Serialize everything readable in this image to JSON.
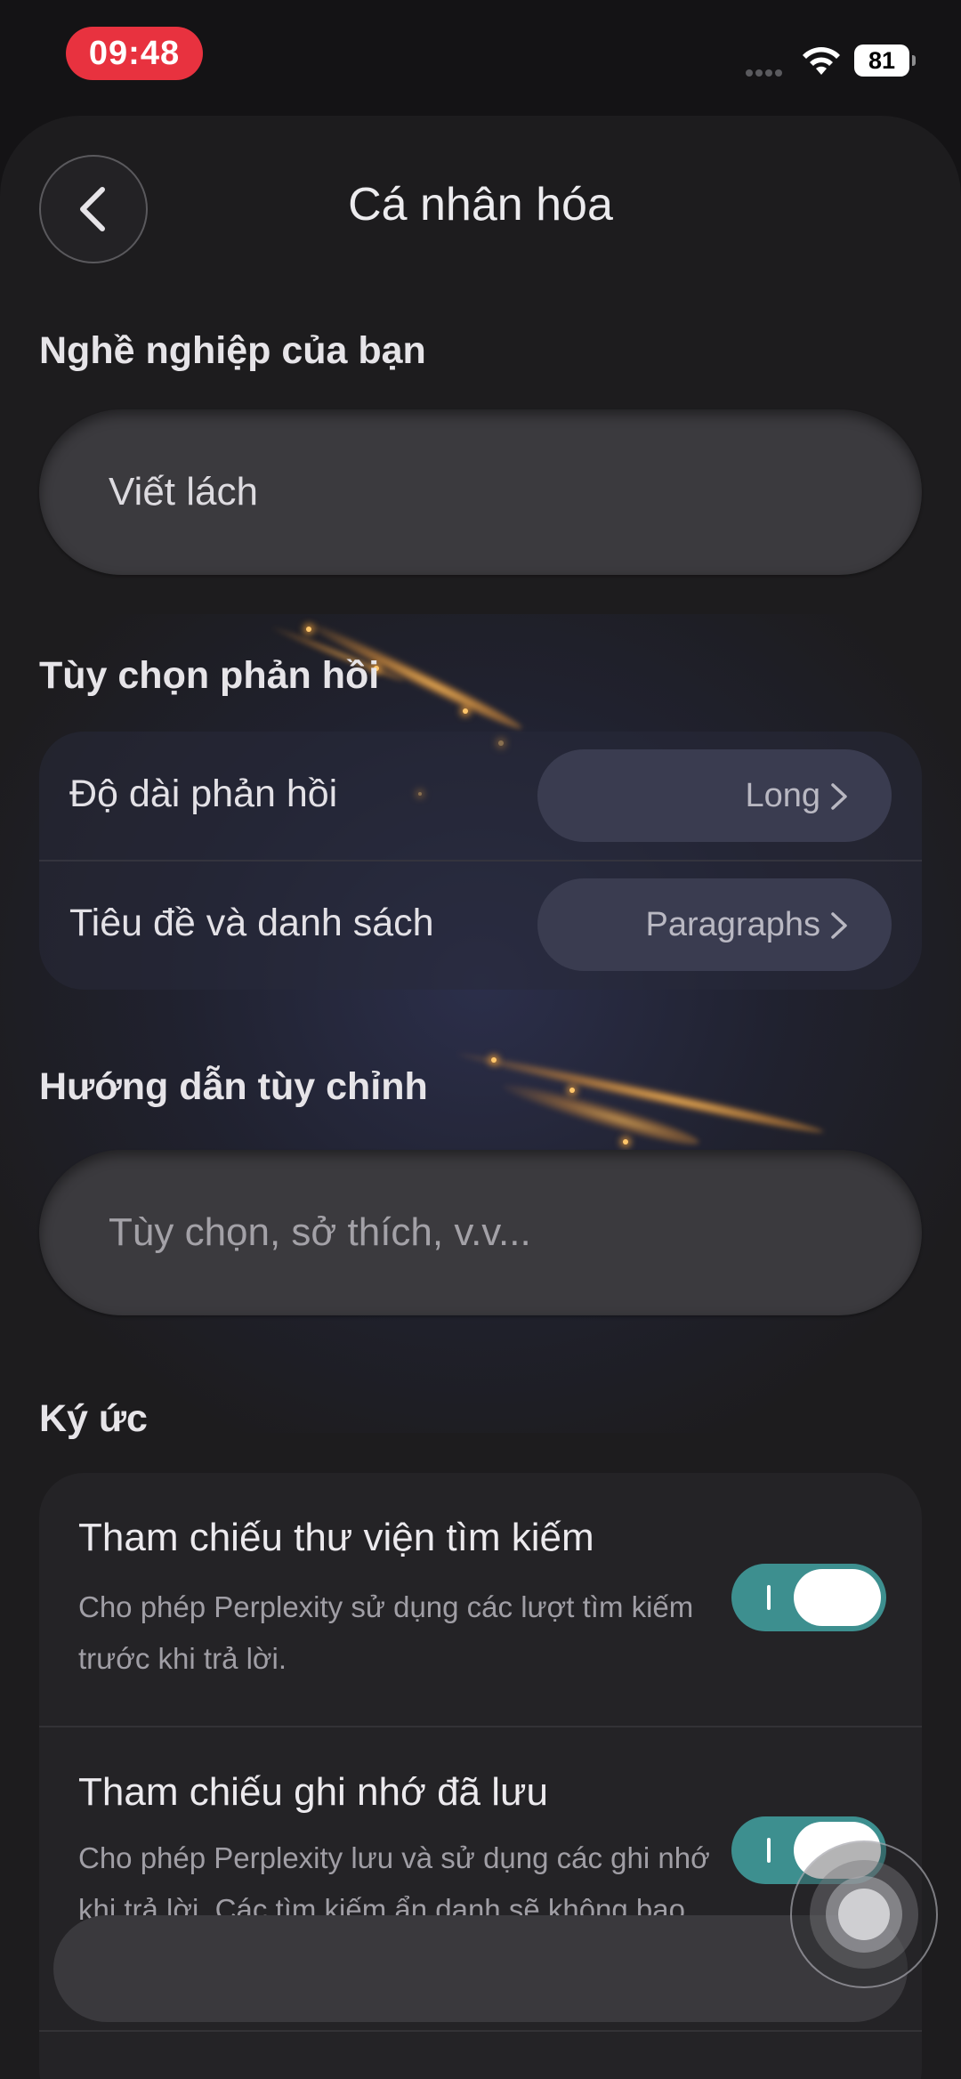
{
  "status_bar": {
    "time": "09:48",
    "battery": "81"
  },
  "header": {
    "title": "Cá nhân hóa"
  },
  "occupation": {
    "label": "Nghề nghiệp của bạn",
    "value": "Viết lách"
  },
  "response_prefs": {
    "label": "Tùy chọn phản hồi",
    "rows": [
      {
        "label": "Độ dài phản hồi",
        "value": "Long"
      },
      {
        "label": "Tiêu đề và danh sách",
        "value": "Paragraphs"
      }
    ]
  },
  "custom_instructions": {
    "label": "Hướng dẫn tùy chỉnh",
    "placeholder": "Tùy chọn, sở thích, v.v..."
  },
  "memory": {
    "label": "Ký ức",
    "items": [
      {
        "title": "Tham chiếu thư viện tìm kiếm",
        "desc": "Cho phép Perplexity sử dụng các lượt tìm kiếm trước khi trả lời.",
        "enabled": true
      },
      {
        "title": "Tham chiếu ghi nhớ đã lưu",
        "desc": "Cho phép Perplexity lưu và sử dụng các ghi nhớ khi trả lời. Các tìm kiếm ẩn danh sẽ không bao giờ được lưu.",
        "enabled": true
      }
    ]
  },
  "colors": {
    "accent_toggle": "#3d8f8f",
    "time_pill": "#e8323f",
    "background": "#1d1c1e"
  },
  "icons": [
    "back-arrow-icon",
    "chevron-right-icon",
    "wifi-icon",
    "battery-icon",
    "assistive-touch-icon"
  ]
}
